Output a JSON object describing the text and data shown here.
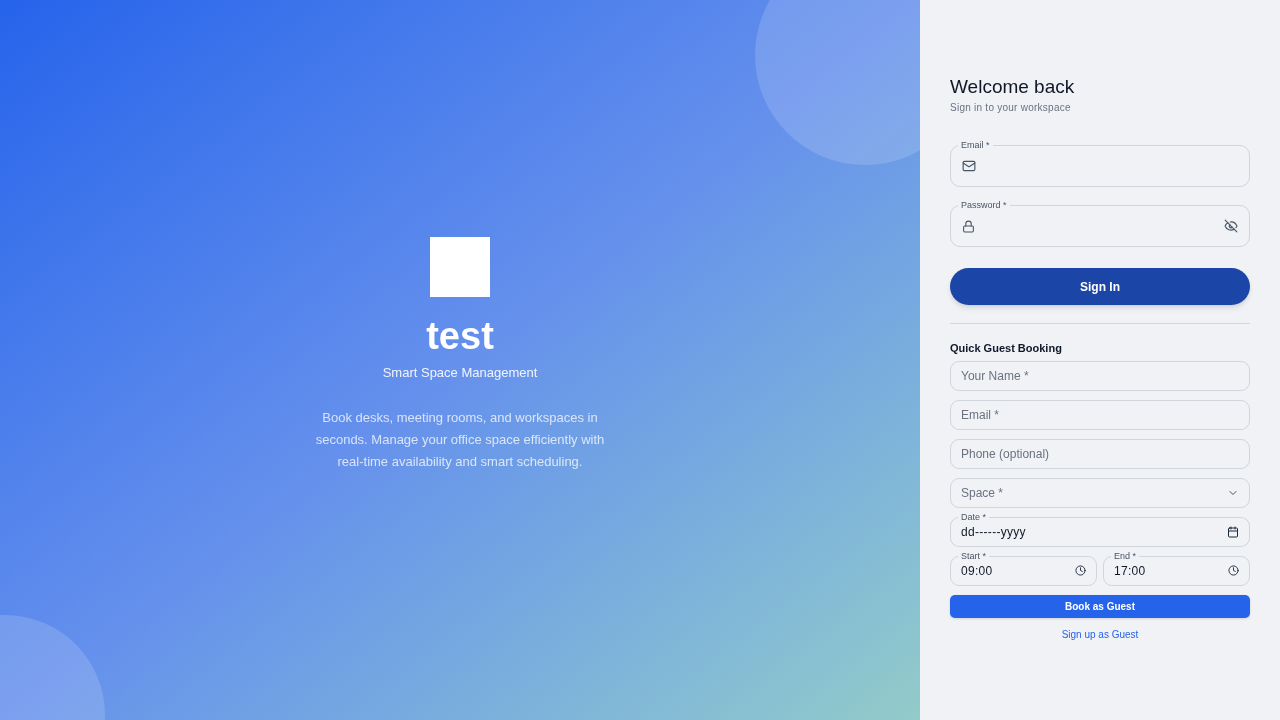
{
  "brand": {
    "name": "test",
    "tagline": "Smart Space Management",
    "description": "Book desks, meeting rooms, and workspaces in seconds. Manage your office space efficiently with real-time availability and smart scheduling."
  },
  "login": {
    "title": "Welcome back",
    "subtitle": "Sign in to your workspace",
    "fields": [
      {
        "kind": "email",
        "label": "Email *"
      },
      {
        "kind": "password",
        "label": "Password *"
      }
    ],
    "submit": "Sign In"
  },
  "guest": {
    "title": "Quick Guest Booking",
    "fields": [
      {
        "kind": "text",
        "placeholder": "Your Name *"
      },
      {
        "kind": "text",
        "placeholder": "Email *"
      },
      {
        "kind": "text",
        "placeholder": "Phone (optional)"
      },
      {
        "kind": "select",
        "placeholder": "Space *"
      },
      {
        "kind": "date",
        "label": "Date *",
        "value": "dd------yyyy"
      }
    ],
    "times": [
      {
        "label": "Start *",
        "value": "09:00"
      },
      {
        "label": "End *",
        "value": "17:00"
      }
    ],
    "submit": "Book as Guest",
    "link": "Sign up as Guest"
  }
}
